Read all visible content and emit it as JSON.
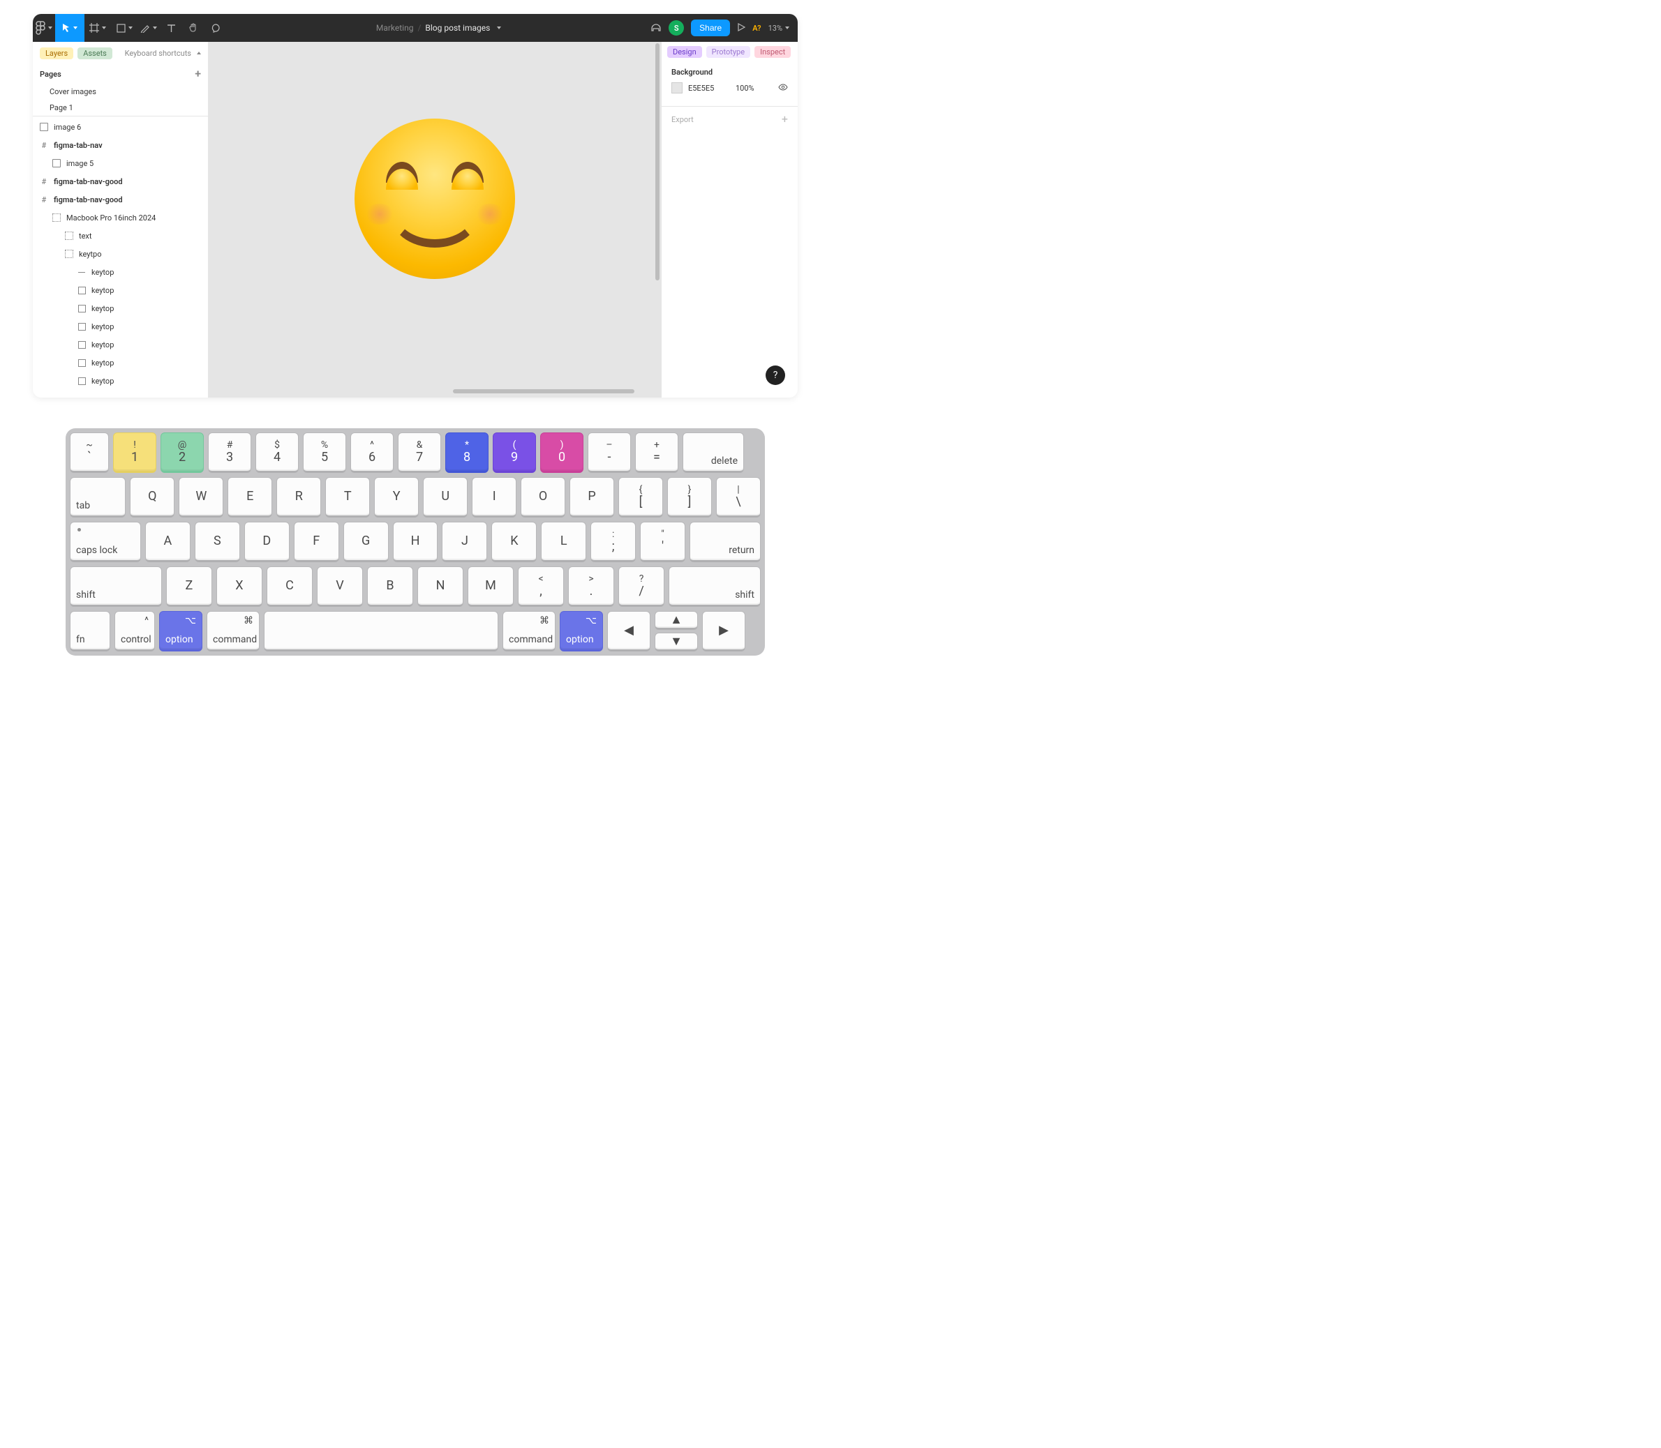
{
  "header": {
    "project": "Marketing",
    "separator": "/",
    "document": "Blog post images",
    "avatar_initial": "S",
    "share_label": "Share",
    "a11y_label": "A?",
    "zoom": "13%"
  },
  "left_panel": {
    "tab_layers": "Layers",
    "tab_assets": "Assets",
    "shortcuts_label": "Keyboard shortcuts",
    "pages_label": "Pages",
    "pages": [
      {
        "label": "Cover images"
      },
      {
        "label": "Page 1"
      }
    ],
    "layers": [
      {
        "icon": "img",
        "label": "image 6",
        "depth": 0,
        "bold": false
      },
      {
        "icon": "frame",
        "label": "figma-tab-nav",
        "depth": 0,
        "bold": true
      },
      {
        "icon": "img",
        "label": "image 5",
        "depth": 1,
        "bold": false
      },
      {
        "icon": "frame",
        "label": "figma-tab-nav-good",
        "depth": 0,
        "bold": true
      },
      {
        "icon": "frame",
        "label": "figma-tab-nav-good",
        "depth": 0,
        "bold": true
      },
      {
        "icon": "grid",
        "label": "Macbook Pro 16inch 2024",
        "depth": 1,
        "bold": false
      },
      {
        "icon": "grid",
        "label": "text",
        "depth": 2,
        "bold": false
      },
      {
        "icon": "grid",
        "label": "keytpo",
        "depth": 2,
        "bold": false
      },
      {
        "icon": "line",
        "label": "keytop",
        "depth": 3,
        "bold": false
      },
      {
        "icon": "rect",
        "label": "keytop",
        "depth": 3,
        "bold": false
      },
      {
        "icon": "rect",
        "label": "keytop",
        "depth": 3,
        "bold": false
      },
      {
        "icon": "rect",
        "label": "keytop",
        "depth": 3,
        "bold": false
      },
      {
        "icon": "rect",
        "label": "keytop",
        "depth": 3,
        "bold": false
      },
      {
        "icon": "rect",
        "label": "keytop",
        "depth": 3,
        "bold": false
      },
      {
        "icon": "rect",
        "label": "keytop",
        "depth": 3,
        "bold": false
      }
    ]
  },
  "right_panel": {
    "tab_design": "Design",
    "tab_prototype": "Prototype",
    "tab_inspect": "Inspect",
    "bg_label": "Background",
    "bg_hex": "E5E5E5",
    "bg_opacity": "100%",
    "export_label": "Export"
  },
  "help_label": "?",
  "keyboard": {
    "row1": [
      {
        "upper": "~",
        "lower": "`",
        "cls": "w-tilde"
      },
      {
        "upper": "!",
        "lower": "1",
        "cls": "w-num",
        "color": "yellow"
      },
      {
        "upper": "@",
        "lower": "2",
        "cls": "w-num",
        "color": "green"
      },
      {
        "upper": "#",
        "lower": "3",
        "cls": "w-num"
      },
      {
        "upper": "$",
        "lower": "4",
        "cls": "w-num"
      },
      {
        "upper": "%",
        "lower": "5",
        "cls": "w-num"
      },
      {
        "upper": "^",
        "lower": "6",
        "cls": "w-num"
      },
      {
        "upper": "&",
        "lower": "7",
        "cls": "w-num"
      },
      {
        "upper": "*",
        "lower": "8",
        "cls": "w-num",
        "color": "blue"
      },
      {
        "upper": "(",
        "lower": "9",
        "cls": "w-num",
        "color": "purple"
      },
      {
        "upper": ")",
        "lower": "0",
        "cls": "w-num",
        "color": "pink"
      },
      {
        "upper": "–",
        "lower": "-",
        "cls": "w-num"
      },
      {
        "upper": "+",
        "lower": "=",
        "cls": "w-num"
      },
      {
        "label": "delete",
        "cls": "w-delete",
        "align": "right"
      }
    ],
    "row2": [
      {
        "label": "tab",
        "cls": "w-tab"
      },
      {
        "lower": "Q",
        "cls": "w-letter"
      },
      {
        "lower": "W",
        "cls": "w-letter"
      },
      {
        "lower": "E",
        "cls": "w-letter"
      },
      {
        "lower": "R",
        "cls": "w-letter"
      },
      {
        "lower": "T",
        "cls": "w-letter"
      },
      {
        "lower": "Y",
        "cls": "w-letter"
      },
      {
        "lower": "U",
        "cls": "w-letter"
      },
      {
        "lower": "I",
        "cls": "w-letter"
      },
      {
        "lower": "O",
        "cls": "w-letter"
      },
      {
        "lower": "P",
        "cls": "w-letter"
      },
      {
        "upper": "{",
        "lower": "[",
        "cls": "w-letter"
      },
      {
        "upper": "}",
        "lower": "]",
        "cls": "w-letter"
      },
      {
        "upper": "|",
        "lower": "\\",
        "cls": "w-letter"
      }
    ],
    "row3": [
      {
        "label": "caps lock",
        "cls": "w-caps",
        "dot": true
      },
      {
        "lower": "A",
        "cls": "w-letter"
      },
      {
        "lower": "S",
        "cls": "w-letter"
      },
      {
        "lower": "D",
        "cls": "w-letter"
      },
      {
        "lower": "F",
        "cls": "w-letter"
      },
      {
        "lower": "G",
        "cls": "w-letter"
      },
      {
        "lower": "H",
        "cls": "w-letter"
      },
      {
        "lower": "J",
        "cls": "w-letter"
      },
      {
        "lower": "K",
        "cls": "w-letter"
      },
      {
        "lower": "L",
        "cls": "w-letter"
      },
      {
        "upper": ":",
        "lower": ";",
        "cls": "w-letter"
      },
      {
        "upper": "\"",
        "lower": "'",
        "cls": "w-letter"
      },
      {
        "label": "return",
        "cls": "w-return",
        "align": "right"
      }
    ],
    "row4": [
      {
        "label": "shift",
        "cls": "w-shift-l"
      },
      {
        "lower": "Z",
        "cls": "w-letter"
      },
      {
        "lower": "X",
        "cls": "w-letter"
      },
      {
        "lower": "C",
        "cls": "w-letter"
      },
      {
        "lower": "V",
        "cls": "w-letter"
      },
      {
        "lower": "B",
        "cls": "w-letter"
      },
      {
        "lower": "N",
        "cls": "w-letter"
      },
      {
        "lower": "M",
        "cls": "w-letter"
      },
      {
        "upper": "<",
        "lower": ",",
        "cls": "w-letter"
      },
      {
        "upper": ">",
        "lower": ".",
        "cls": "w-letter"
      },
      {
        "upper": "?",
        "lower": "/",
        "cls": "w-letter"
      },
      {
        "label": "shift",
        "cls": "w-shift-r",
        "align": "right"
      }
    ],
    "row5_left": [
      {
        "label": "fn",
        "cls": "w-fn"
      },
      {
        "label": "control",
        "sym": "^",
        "cls": "w-ctrl"
      },
      {
        "label": "option",
        "sym": "⌥",
        "cls": "w-opt",
        "color": "indigo"
      },
      {
        "label": "command",
        "sym": "⌘",
        "cls": "w-cmd"
      }
    ],
    "row5_space": {
      "cls": "w-space"
    },
    "row5_right": [
      {
        "label": "command",
        "sym": "⌘",
        "cls": "w-cmd"
      },
      {
        "label": "option",
        "sym": "⌥",
        "cls": "w-opt",
        "color": "indigo"
      }
    ],
    "arrows": {
      "left": "◀",
      "up": "▲",
      "down": "▼",
      "right": "▶"
    }
  }
}
